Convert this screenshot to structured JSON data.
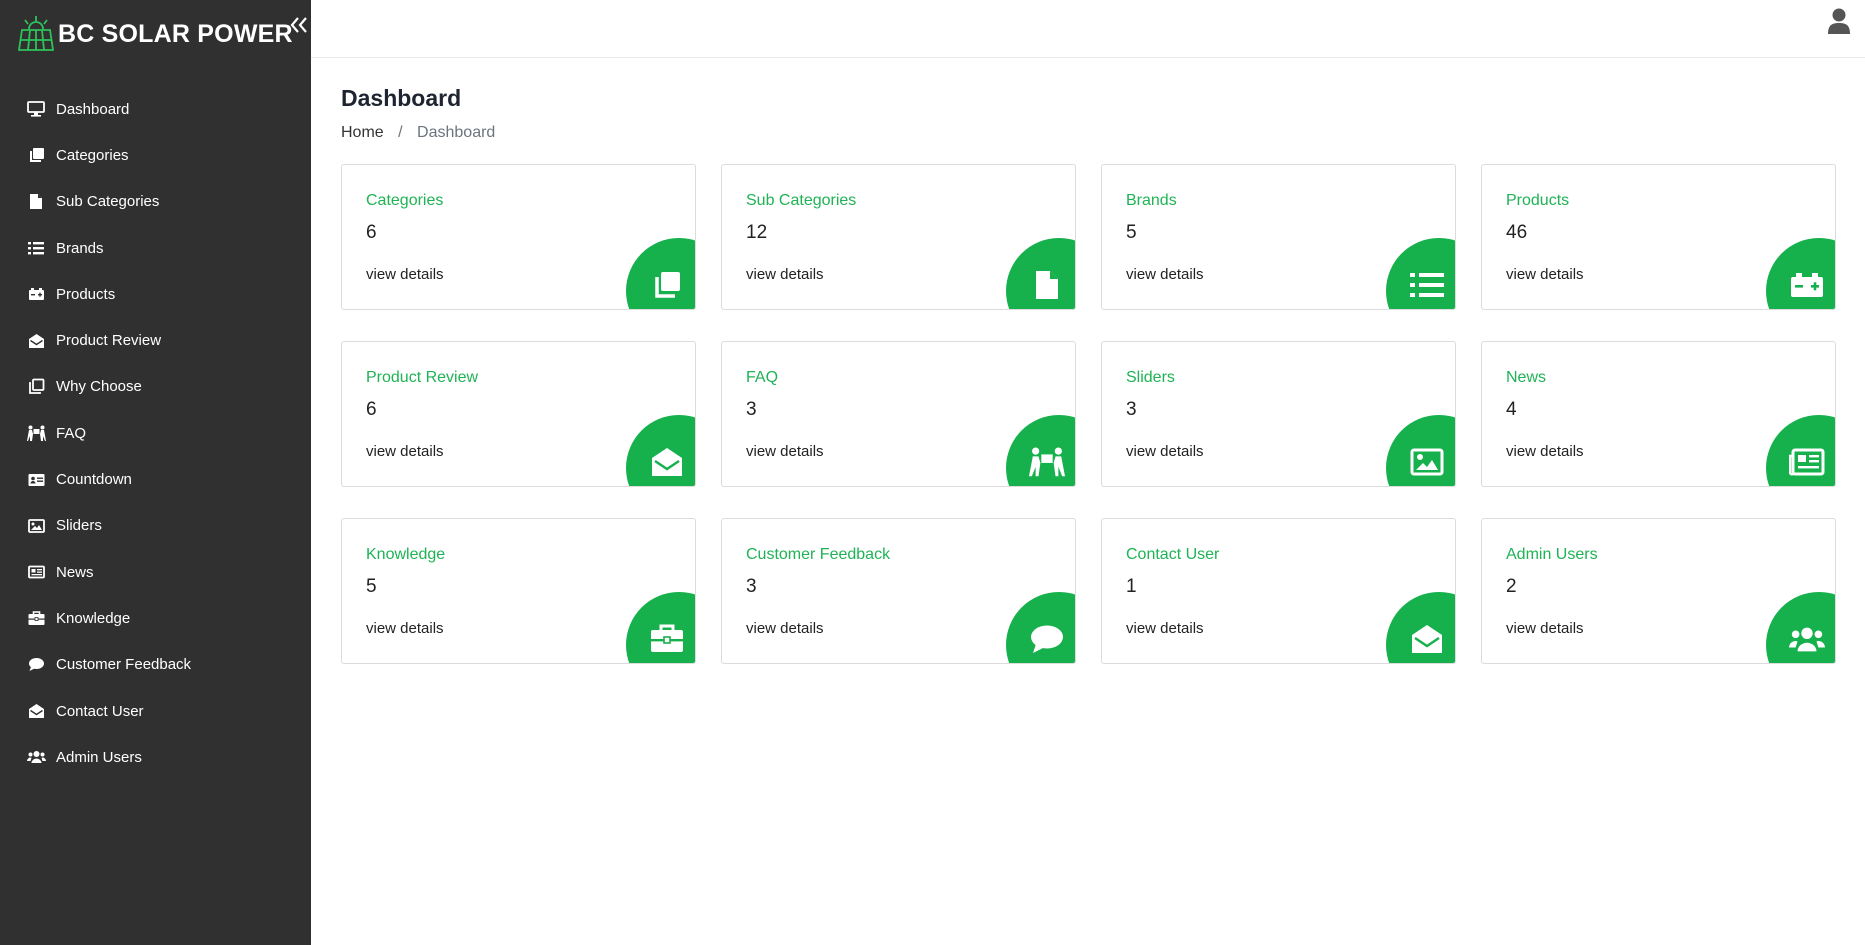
{
  "app": {
    "title": "BC SOLAR POWER"
  },
  "sidebar": {
    "items": [
      {
        "label": "Dashboard",
        "icon": "monitor-icon"
      },
      {
        "label": "Categories",
        "icon": "copy-icon"
      },
      {
        "label": "Sub Categories",
        "icon": "file-icon"
      },
      {
        "label": "Brands",
        "icon": "list-icon"
      },
      {
        "label": "Products",
        "icon": "battery-icon"
      },
      {
        "label": "Product Review",
        "icon": "envelope-open-icon"
      },
      {
        "label": "Why Choose",
        "icon": "clone-icon"
      },
      {
        "label": "FAQ",
        "icon": "people-carry-icon"
      },
      {
        "label": "Countdown",
        "icon": "id-card-icon"
      },
      {
        "label": "Sliders",
        "icon": "image-icon"
      },
      {
        "label": "News",
        "icon": "newspaper-icon"
      },
      {
        "label": "Knowledge",
        "icon": "briefcase-icon"
      },
      {
        "label": "Customer Feedback",
        "icon": "comment-icon"
      },
      {
        "label": "Contact User",
        "icon": "envelope-open-icon"
      },
      {
        "label": "Admin Users",
        "icon": "users-icon"
      }
    ]
  },
  "page": {
    "title": "Dashboard",
    "breadcrumb": {
      "home": "Home",
      "separator": "/",
      "current": "Dashboard"
    }
  },
  "cards": [
    {
      "title": "Categories",
      "count": "6",
      "link": "view details",
      "icon": "copy-icon"
    },
    {
      "title": "Sub Categories",
      "count": "12",
      "link": "view details",
      "icon": "file-icon"
    },
    {
      "title": "Brands",
      "count": "5",
      "link": "view details",
      "icon": "list-icon"
    },
    {
      "title": "Products",
      "count": "46",
      "link": "view details",
      "icon": "battery-icon"
    },
    {
      "title": "Product Review",
      "count": "6",
      "link": "view details",
      "icon": "envelope-open-icon"
    },
    {
      "title": "FAQ",
      "count": "3",
      "link": "view details",
      "icon": "people-carry-icon"
    },
    {
      "title": "Sliders",
      "count": "3",
      "link": "view details",
      "icon": "image-icon"
    },
    {
      "title": "News",
      "count": "4",
      "link": "view details",
      "icon": "newspaper-icon"
    },
    {
      "title": "Knowledge",
      "count": "5",
      "link": "view details",
      "icon": "briefcase-icon"
    },
    {
      "title": "Customer Feedback",
      "count": "3",
      "link": "view details",
      "icon": "comment-icon"
    },
    {
      "title": "Contact User",
      "count": "1",
      "link": "view details",
      "icon": "envelope-open-icon"
    },
    {
      "title": "Admin Users",
      "count": "2",
      "link": "view details",
      "icon": "users-icon"
    }
  ],
  "colors": {
    "accent": "#16b14c",
    "sidebar_bg": "#303030",
    "card_title": "#1fb355"
  }
}
